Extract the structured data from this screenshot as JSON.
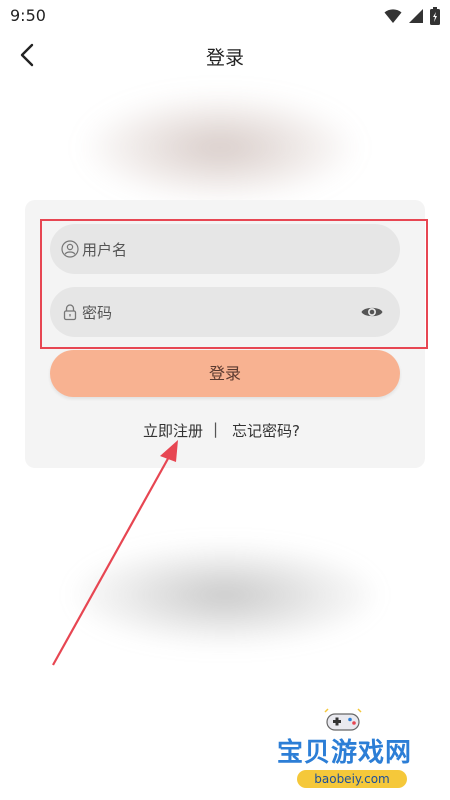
{
  "status_bar": {
    "time": "9:50",
    "icons": [
      "wifi-icon",
      "signal-icon",
      "battery-icon"
    ]
  },
  "nav": {
    "title": "登录",
    "back_icon": "chevron-left-icon"
  },
  "form": {
    "username": {
      "placeholder": "用户名",
      "icon": "user-icon"
    },
    "password": {
      "placeholder": "密码",
      "icon": "lock-icon",
      "toggle_icon": "eye-icon"
    },
    "login_label": "登录"
  },
  "links": {
    "register": "立即注册",
    "divider": "|",
    "forgot": "忘记密码?"
  },
  "annotation": {
    "highlight_color": "#e74652",
    "arrow_color": "#e74652"
  },
  "watermark": {
    "text": "宝贝游戏网",
    "url": "baobeiy.com"
  },
  "colors": {
    "login_button": "#f8b291",
    "card": "#f4f4f4",
    "field": "#e6e6e6"
  }
}
